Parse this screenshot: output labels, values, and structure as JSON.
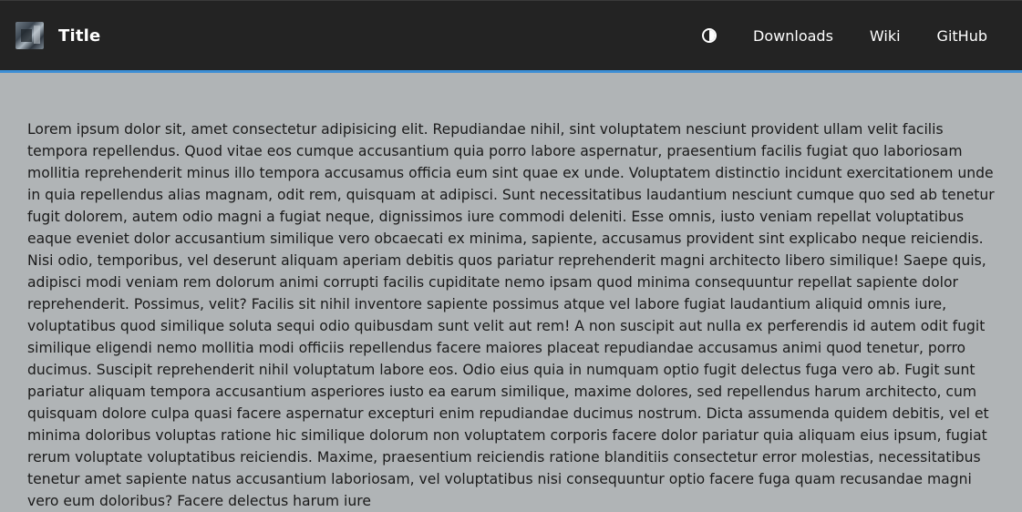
{
  "navbar": {
    "title": "Title",
    "logo": "logo-image",
    "theme_toggle_icon": "half-circle-contrast-icon",
    "links": [
      "Downloads",
      "Wiki",
      "GitHub"
    ],
    "accent_color": "#3d8fd6",
    "background_color": "#232323"
  },
  "main": {
    "background_color": "#b0b4b6",
    "paragraph": "Lorem ipsum dolor sit, amet consectetur adipisicing elit. Repudiandae nihil, sint voluptatem nesciunt provident ullam velit facilis tempora repellendus. Quod vitae eos cumque accusantium quia porro labore aspernatur, praesentium facilis fugiat quo laboriosam mollitia reprehenderit minus illo tempora accusamus officia eum sint quae ex unde. Voluptatem distinctio incidunt exercitationem unde in quia repellendus alias magnam, odit rem, quisquam at adipisci. Sunt necessitatibus laudantium nesciunt cumque quo sed ab tenetur fugit dolorem, autem odio magni a fugiat neque, dignissimos iure commodi deleniti. Esse omnis, iusto veniam repellat voluptatibus eaque eveniet dolor accusantium similique vero obcaecati ex minima, sapiente, accusamus provident sint explicabo neque reiciendis. Nisi odio, temporibus, vel deserunt aliquam aperiam debitis quos pariatur reprehenderit magni architecto libero similique! Saepe quis, adipisci modi veniam rem dolorum animi corrupti facilis cupiditate nemo ipsam quod minima consequuntur repellat sapiente dolor reprehenderit. Possimus, velit? Facilis sit nihil inventore sapiente possimus atque vel labore fugiat laudantium aliquid omnis iure, voluptatibus quod similique soluta sequi odio quibusdam sunt velit aut rem! A non suscipit aut nulla ex perferendis id autem odit fugit similique eligendi nemo mollitia modi officiis repellendus facere maiores placeat repudiandae accusamus animi quod tenetur, porro ducimus. Suscipit reprehenderit nihil voluptatum labore eos. Odio eius quia in numquam optio fugit delectus fuga vero ab. Fugit sunt pariatur aliquam tempora accusantium asperiores iusto ea earum similique, maxime dolores, sed repellendus harum architecto, cum quisquam dolore culpa quasi facere aspernatur excepturi enim repudiandae ducimus nostrum. Dicta assumenda quidem debitis, vel et minima doloribus voluptas ratione hic similique dolorum non voluptatem corporis facere dolor pariatur quia aliquam eius ipsum, fugiat rerum voluptate voluptatibus reiciendis. Maxime, praesentium reiciendis ratione blanditiis consectetur error molestias, necessitatibus tenetur amet sapiente natus accusantium laboriosam, vel voluptatibus nisi consequuntur optio facere fuga quam recusandae magni vero eum doloribus? Facere delectus harum iure"
  }
}
